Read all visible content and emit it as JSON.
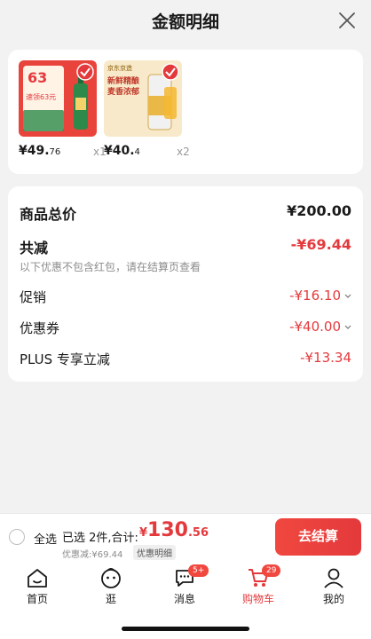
{
  "header": {
    "title": "金额明细"
  },
  "products": [
    {
      "price_int": "¥49.",
      "price_dec": "76",
      "qty": "x1",
      "thumb_badge": "63",
      "thumb_text": "速领63元"
    },
    {
      "price_int": "¥40.",
      "price_dec": "4",
      "qty": "x2",
      "thumb_brand": "京东京造",
      "thumb_text": "新鲜精酿麦香浓郁"
    }
  ],
  "summary": {
    "total_label": "商品总价",
    "total_value": "¥200.00",
    "reduce_label": "共减",
    "reduce_value": "-¥69.44",
    "note": "以下优惠不包含红包，请在结算页查看",
    "promo_label": "促销",
    "promo_value": "-¥16.10",
    "coupon_label": "优惠券",
    "coupon_value": "-¥40.00",
    "plus_label": "PLUS 专享立减",
    "plus_value": "-¥13.34"
  },
  "checkout": {
    "select_all": "全选",
    "selected": "已选 2件,合计:",
    "currency": "¥",
    "total_int": "130",
    "total_dec": ".56",
    "discount": "优惠减:¥69.44",
    "detail_tag": "优惠明细",
    "pay_button": "去结算"
  },
  "tabbar": {
    "home": "首页",
    "browse": "逛",
    "messages": "消息",
    "messages_badge": "5+",
    "cart": "购物车",
    "cart_badge": "29",
    "mine": "我的"
  },
  "colors": {
    "accent": "#e4393c",
    "background": "#f2f2f2"
  }
}
